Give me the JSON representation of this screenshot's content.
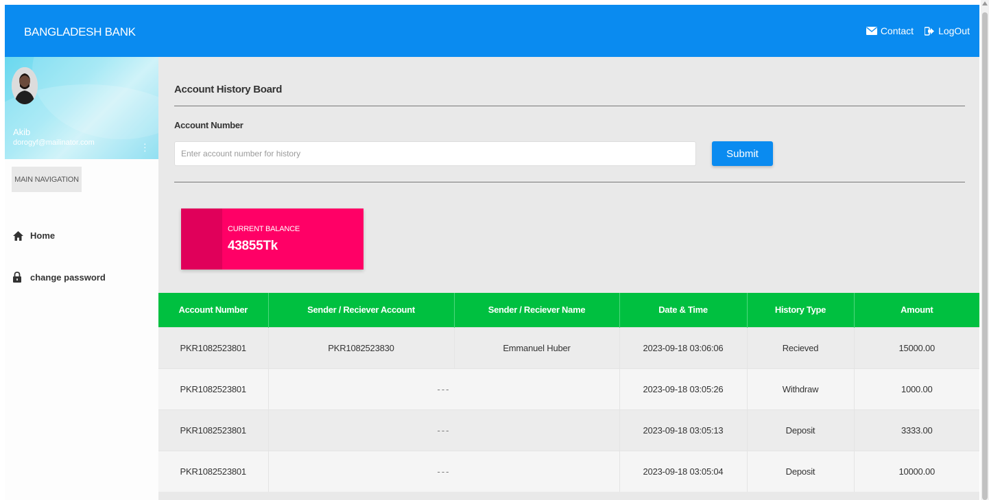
{
  "header": {
    "brand": "BANGLADESH BANK",
    "contact_label": "Contact",
    "logout_label": "LogOut"
  },
  "sidebar": {
    "user": {
      "name": "Akib",
      "email": "dorogyf@mailinator.com"
    },
    "nav_header": "MAIN NAVIGATION",
    "items": [
      {
        "label": "Home",
        "icon": "home-icon"
      },
      {
        "label": "change password",
        "icon": "lock-icon"
      }
    ]
  },
  "main": {
    "title": "Account History Board",
    "account_label": "Account Number",
    "account_placeholder": "Enter account number for history",
    "account_value": "",
    "submit_label": "Submit",
    "balance": {
      "label": "CURRENT BALANCE",
      "value": "43855Tk"
    },
    "table": {
      "headers": [
        "Account Number",
        "Sender / Reciever Account",
        "Sender / Reciever Name",
        "Date & Time",
        "History Type",
        "Amount"
      ],
      "rows": [
        {
          "account": "PKR1082523801",
          "sender_account": "PKR1082523830",
          "sender_name": "Emmanuel Huber",
          "datetime": "2023-09-18 03:06:06",
          "type": "Recieved",
          "amount": "15000.00"
        },
        {
          "account": "PKR1082523801",
          "placeholder": "---",
          "datetime": "2023-09-18 03:05:26",
          "type": "Withdraw",
          "amount": "1000.00"
        },
        {
          "account": "PKR1082523801",
          "placeholder": "---",
          "datetime": "2023-09-18 03:05:13",
          "type": "Deposit",
          "amount": "3333.00"
        },
        {
          "account": "PKR1082523801",
          "placeholder": "---",
          "datetime": "2023-09-18 03:05:04",
          "type": "Deposit",
          "amount": "10000.00"
        }
      ]
    }
  },
  "colors": {
    "primary": "#0a8bf0",
    "table_header": "#00c040",
    "balance_card": "#ff0066"
  }
}
